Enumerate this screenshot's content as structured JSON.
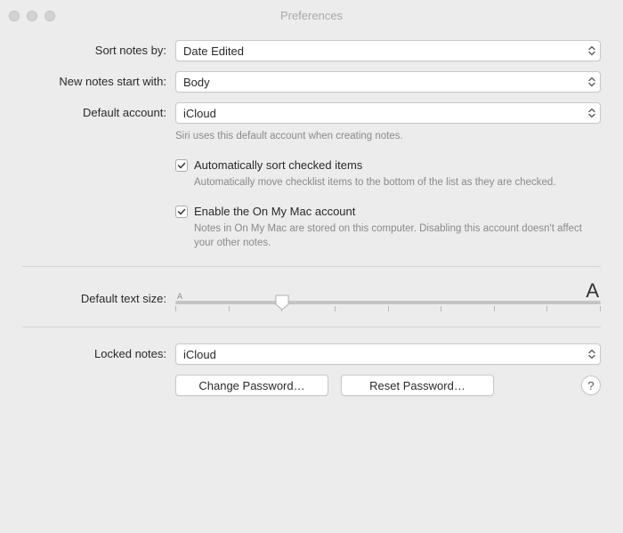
{
  "window": {
    "title": "Preferences"
  },
  "labels": {
    "sort_notes": "Sort notes by:",
    "new_notes": "New notes start with:",
    "default_account": "Default account:",
    "default_text_size": "Default text size:",
    "locked_notes": "Locked notes:"
  },
  "selects": {
    "sort_notes_value": "Date Edited",
    "new_notes_value": "Body",
    "default_account_value": "iCloud",
    "locked_notes_value": "iCloud"
  },
  "helper": {
    "default_account": "Siri uses this default account when creating notes."
  },
  "checkboxes": {
    "auto_sort": {
      "label": "Automatically sort checked items",
      "desc": "Automatically move checklist items to the bottom of the list as they are checked.",
      "checked": true
    },
    "enable_onmymac": {
      "label": "Enable the On My Mac account",
      "desc": "Notes in On My Mac are stored on this computer. Disabling this account doesn't affect your other notes.",
      "checked": true
    }
  },
  "slider": {
    "small_mark": "A",
    "large_mark": "A",
    "ticks": 9,
    "value_index": 2
  },
  "buttons": {
    "change_password": "Change Password…",
    "reset_password": "Reset Password…",
    "help": "?"
  }
}
